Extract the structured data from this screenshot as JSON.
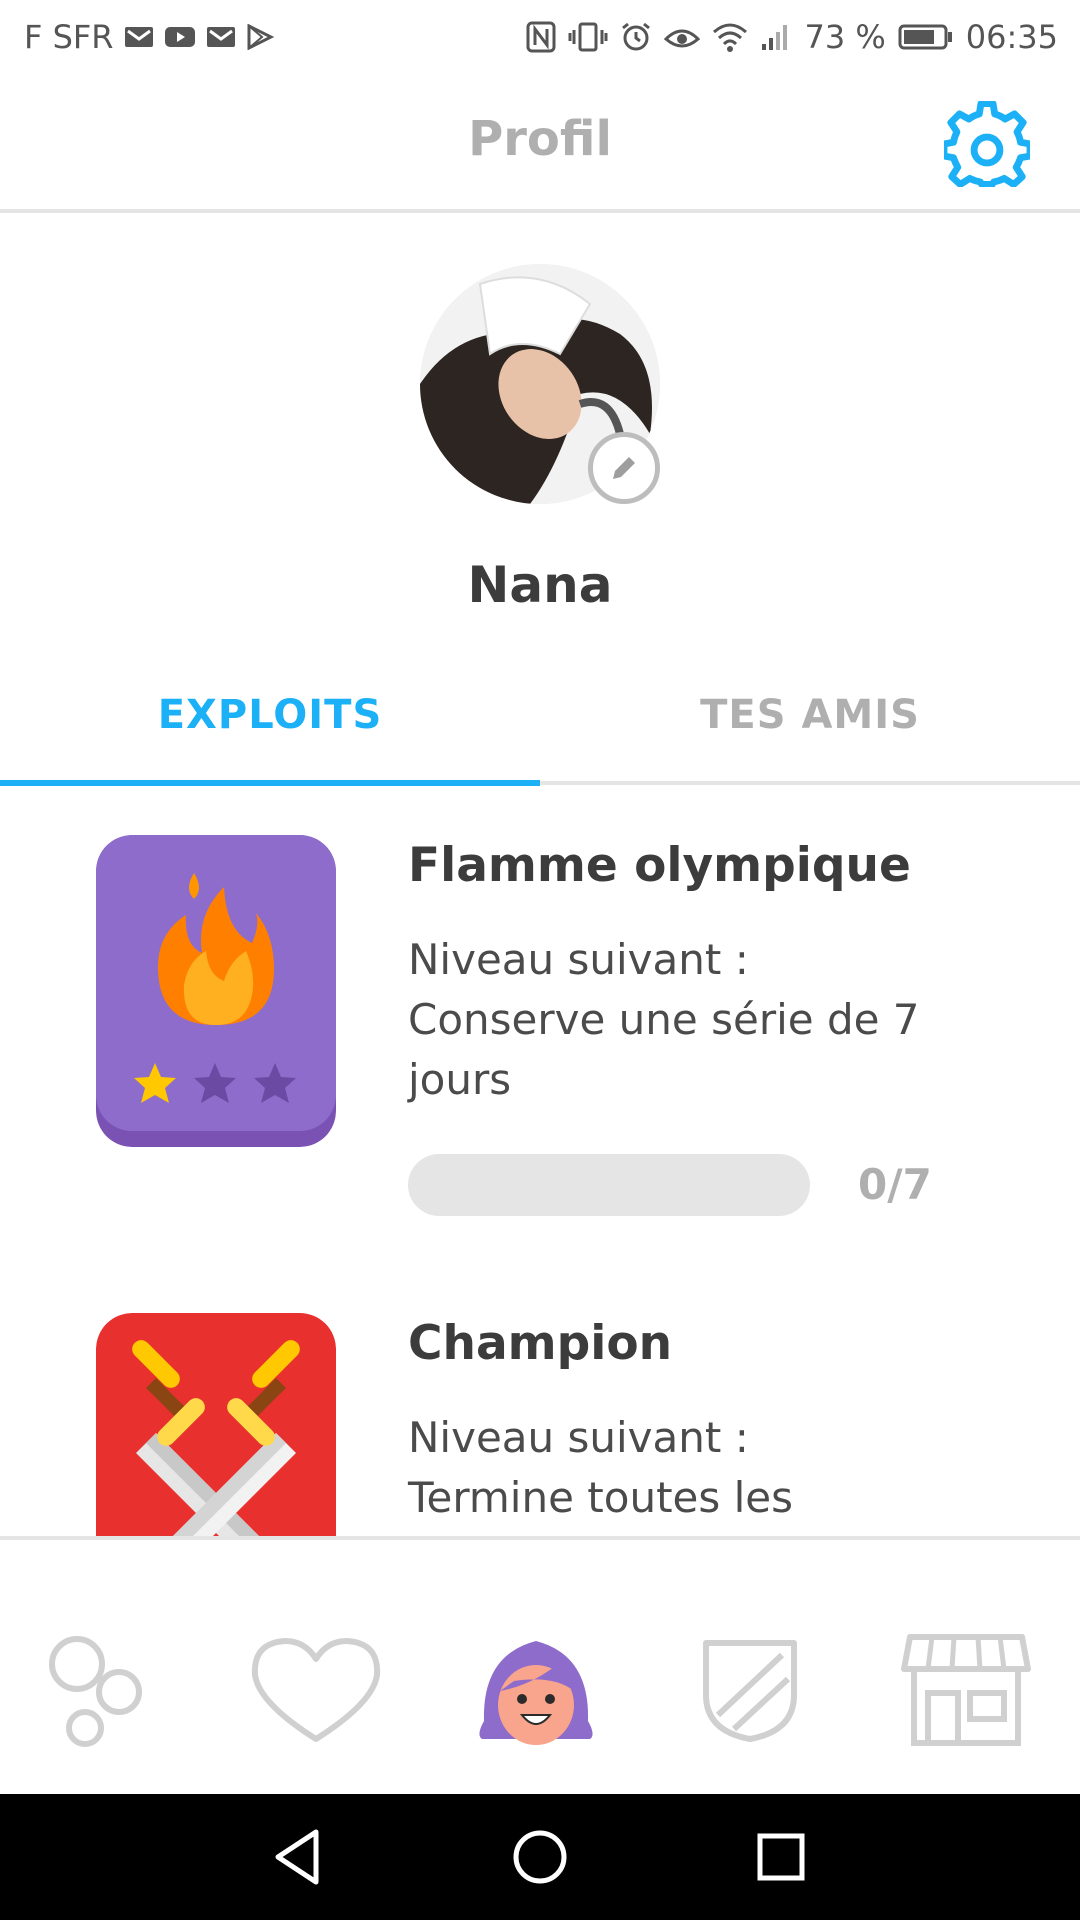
{
  "statusbar": {
    "carrier": "F SFR",
    "battery": "73 %",
    "time": "06:35"
  },
  "header": {
    "title": "Profil",
    "settings_icon": "gear-icon"
  },
  "profile": {
    "username": "Nana",
    "edit_icon": "pencil-icon"
  },
  "tabs": [
    {
      "label": "EXPLOITS",
      "active": true
    },
    {
      "label": "TES AMIS",
      "active": false
    }
  ],
  "achievements": [
    {
      "title": "Flamme olympique",
      "description": "Niveau suivant :\nConserve une série de 7 jours",
      "progress_label": "0/7",
      "progress_value": 0,
      "progress_max": 7,
      "stars_earned": 1,
      "stars_total": 3,
      "badge_color": "#8e6ccc",
      "icon": "flame-icon"
    },
    {
      "title": "Champion",
      "description": "Niveau suivant :\nTermine toutes les",
      "badge_color": "#e8302e",
      "icon": "crossed-swords-icon"
    }
  ],
  "bottomnav": [
    {
      "icon": "learn-bubbles-icon",
      "active": false
    },
    {
      "icon": "heart-icon",
      "active": false
    },
    {
      "icon": "profile-avatar-icon",
      "active": true
    },
    {
      "icon": "league-shield-icon",
      "active": false
    },
    {
      "icon": "shop-icon",
      "active": false
    }
  ],
  "colors": {
    "accent": "#1cb0f6",
    "inactive": "#afafaf",
    "divider": "#e5e5e5"
  }
}
